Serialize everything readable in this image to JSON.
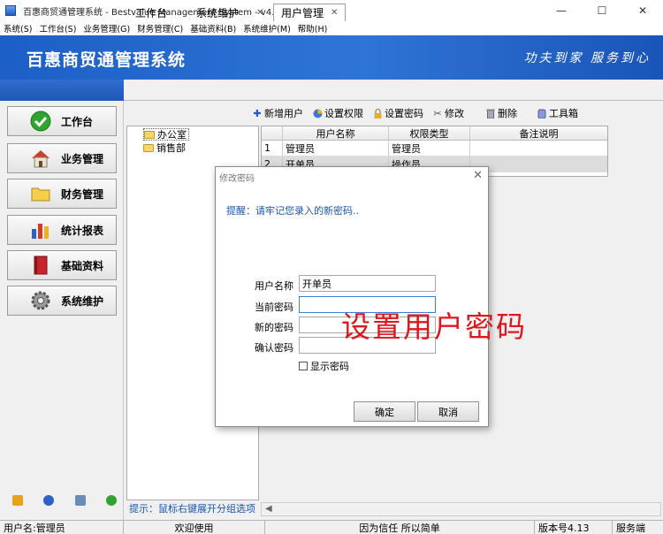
{
  "window": {
    "title": "百惠商贸通管理系统 - Bestvalue Management System - v4.13",
    "controls": [
      "—",
      "☐",
      "✕"
    ]
  },
  "menu": [
    "系统(S)",
    "工作台(S)",
    "业务管理(G)",
    "财务管理(C)",
    "基础资料(B)",
    "系统维护(M)",
    "帮助(H)"
  ],
  "banner": {
    "title": "百惠商贸通管理系统",
    "slogan": "功夫到家 服务到心"
  },
  "nav": [
    {
      "label": "工作台",
      "icon": "check-icon"
    },
    {
      "label": "业务管理",
      "icon": "house-icon"
    },
    {
      "label": "财务管理",
      "icon": "folder-icon"
    },
    {
      "label": "统计报表",
      "icon": "bar-chart-icon"
    },
    {
      "label": "基础资料",
      "icon": "book-icon"
    },
    {
      "label": "系统维护",
      "icon": "gear-icon"
    }
  ],
  "tabs": [
    {
      "label": "工作台",
      "closable": false,
      "active": false
    },
    {
      "label": "系统维护",
      "closable": true,
      "active": false
    },
    {
      "label": "用户管理",
      "closable": true,
      "active": true
    }
  ],
  "toolbar": [
    {
      "label": "新增用户",
      "icon": "plus-icon"
    },
    {
      "label": "设置权限",
      "icon": "shield-icon"
    },
    {
      "label": "设置密码",
      "icon": "lock-icon"
    },
    {
      "label": "修改",
      "icon": "tools-icon"
    },
    {
      "label": "删除",
      "icon": "trash-icon"
    },
    {
      "label": "工具箱",
      "icon": "toolbox-icon"
    }
  ],
  "tree": [
    "办公室",
    "销售部"
  ],
  "tree_hint": "提示：鼠标右键展开分组选项",
  "grid": {
    "columns": [
      "用户名称",
      "权限类型",
      "备注说明"
    ],
    "rows": [
      {
        "num": "1",
        "name": "管理员",
        "type": "管理员",
        "note": ""
      },
      {
        "num": "2",
        "name": "开单员",
        "type": "操作员",
        "note": ""
      }
    ]
  },
  "dialog": {
    "title": "修改密码",
    "reminder": "提醒：请牢记您录入的新密码..",
    "fields": [
      {
        "label": "用户名称",
        "value": "开单员"
      },
      {
        "label": "当前密码",
        "value": ""
      },
      {
        "label": "新的密码",
        "value": ""
      },
      {
        "label": "确认密码",
        "value": ""
      }
    ],
    "show_password_label": "显示密码",
    "ok_label": "确定",
    "cancel_label": "取消",
    "close_glyph": "✕"
  },
  "overlay_caption": "设置用户密码",
  "status": {
    "user": "用户名:管理员",
    "welcome": "欢迎使用",
    "motto": "因为信任 所以简单",
    "version": "版本号4.13",
    "mode": "服务端"
  },
  "colors": {
    "banner": "#1c5fc6",
    "hint": "#1a56b0",
    "overlay": "#e0161b"
  }
}
